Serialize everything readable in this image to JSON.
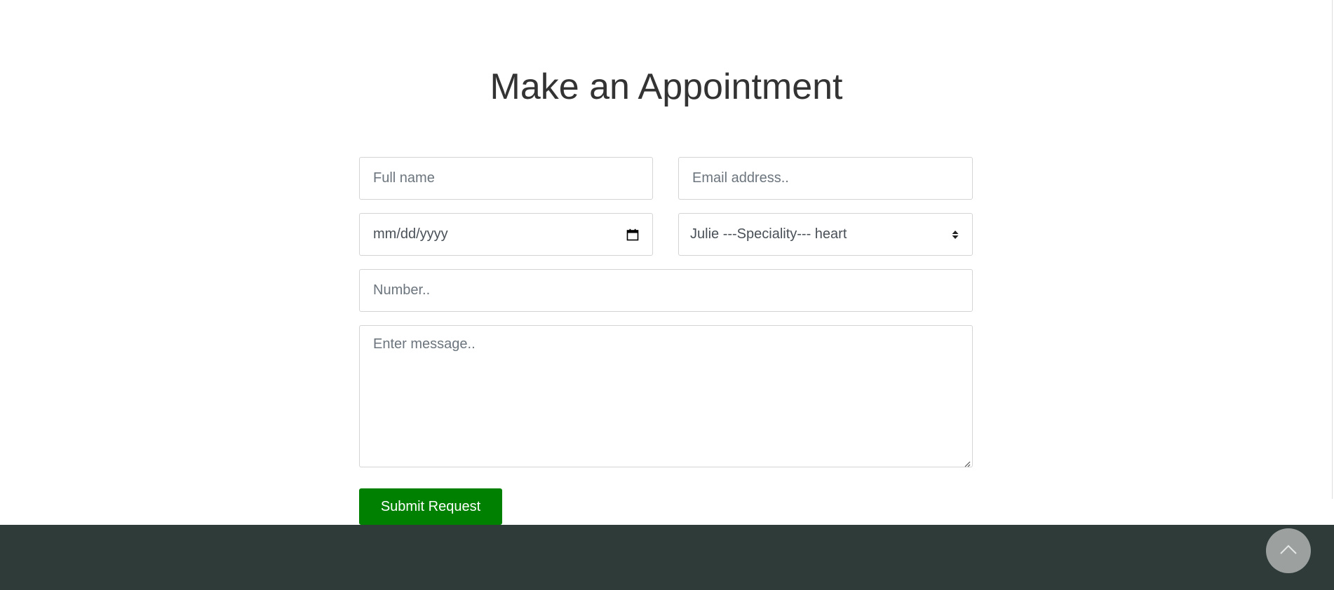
{
  "page": {
    "title": "Make an Appointment"
  },
  "form": {
    "full_name_placeholder": "Full name",
    "email_placeholder": "Email address..",
    "date_placeholder": "mm/dd/yyyy",
    "doctor_select_value": "Julie ---Speciality--- heart",
    "number_placeholder": "Number..",
    "message_placeholder": "Enter message..",
    "submit_label": "Submit Request"
  },
  "colors": {
    "submit_bg": "#008000",
    "footer_bg": "#2e3b38",
    "scroll_top_bg": "#9ca1a0"
  },
  "icons": {
    "date": "calendar-icon",
    "select": "sort-arrows-icon",
    "scroll_top": "chevron-up-icon"
  }
}
